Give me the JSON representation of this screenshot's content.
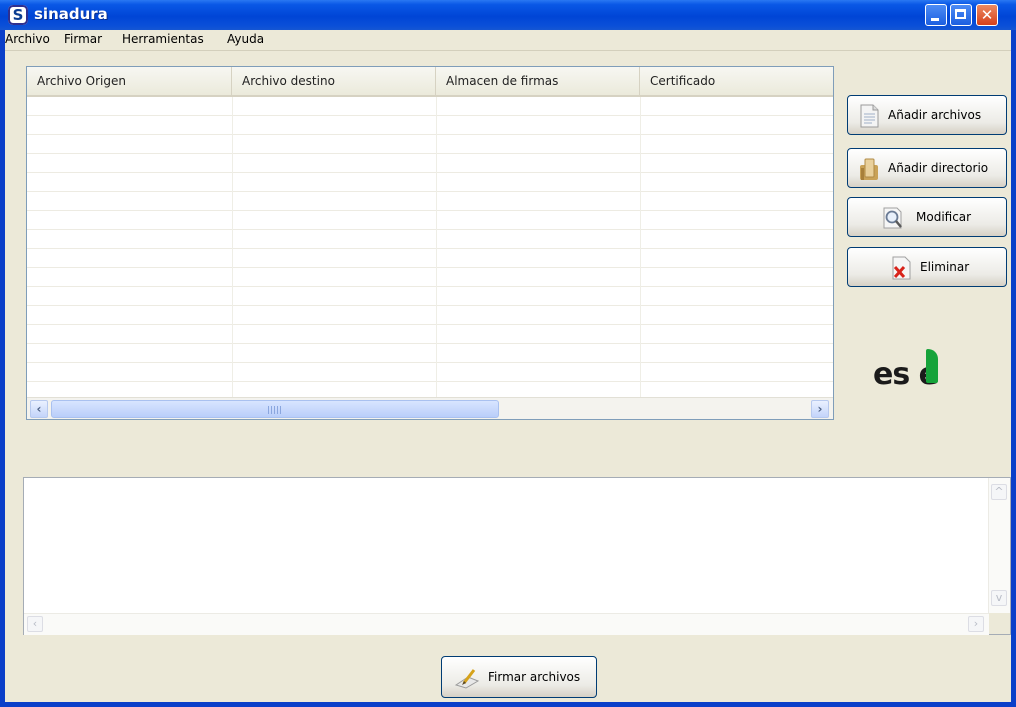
{
  "window": {
    "title": "sinadura",
    "app_icon_letter": "S"
  },
  "menu": [
    "Archivo",
    "Firmar",
    "Herramientas",
    "Ayuda"
  ],
  "table": {
    "columns": [
      "Archivo Origen",
      "Archivo destino",
      "Almacen de firmas",
      "Certificado"
    ],
    "rows": []
  },
  "side_buttons": {
    "add_files": "Añadir archivos",
    "add_dir": "Añadir directorio",
    "modify": "Modificar",
    "delete": "Eliminar"
  },
  "logo": {
    "text": "es e"
  },
  "log": {
    "value": ""
  },
  "sign_button": "Firmar archivos",
  "colors": {
    "title_bar": "#0a58e6",
    "window_bg": "#ece9d8",
    "logo_green": "#16a33a",
    "border": "#003c74"
  }
}
